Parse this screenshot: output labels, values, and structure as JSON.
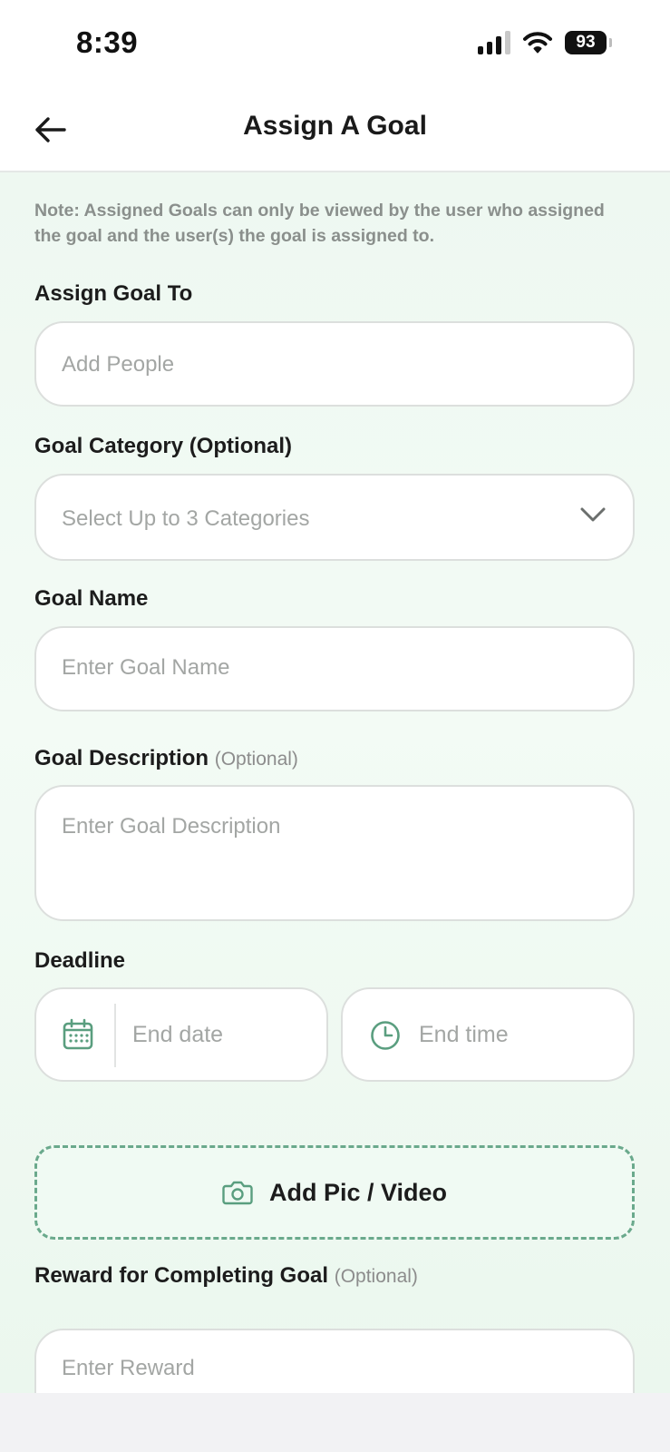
{
  "status_bar": {
    "time": "8:39",
    "battery": "93"
  },
  "header": {
    "title": "Assign A Goal"
  },
  "note": "Note: Assigned Goals can only be viewed by the user who assigned the goal and the user(s) the goal is assigned to.",
  "assign_to": {
    "label": "Assign Goal To",
    "placeholder": "Add People"
  },
  "category": {
    "label": "Goal Category (Optional)",
    "placeholder": "Select Up to 3 Categories"
  },
  "goal_name": {
    "label": "Goal Name",
    "placeholder": "Enter Goal Name"
  },
  "description": {
    "label": "Goal Description",
    "optional": "(Optional)",
    "placeholder": "Enter Goal Description"
  },
  "deadline": {
    "label": "Deadline",
    "date_placeholder": "End date",
    "time_placeholder": "End time"
  },
  "upload": {
    "label": "Add Pic / Video"
  },
  "reward": {
    "label": "Reward for Completing Goal",
    "optional": "(Optional)",
    "placeholder": "Enter Reward"
  },
  "colors": {
    "accent": "#5a9e7f",
    "dashed_border": "#6aa98c",
    "label_text": "#1c1c1c",
    "placeholder_text": "#a3a6a4"
  },
  "icons": [
    "back-arrow-icon",
    "chevron-down-icon",
    "calendar-icon",
    "clock-icon",
    "camera-icon",
    "signal-icon",
    "wifi-icon",
    "battery-icon"
  ]
}
